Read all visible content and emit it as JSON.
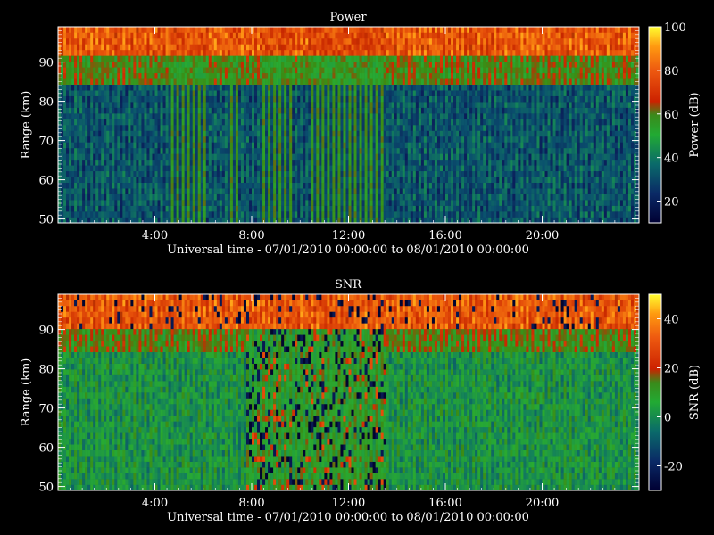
{
  "chart_data": [
    {
      "type": "heatmap",
      "title": "Power",
      "xlabel": "Universal time - 07/01/2010 00:00:00 to 08/01/2010 00:00:00",
      "ylabel": "Range (km)",
      "x_ticks": [
        "4:00",
        "8:00",
        "12:00",
        "16:00",
        "20:00"
      ],
      "x_tick_hours": [
        4,
        8,
        12,
        16,
        20
      ],
      "xlim_hours": [
        0,
        24
      ],
      "y_ticks": [
        50,
        60,
        70,
        80,
        90
      ],
      "ylim": [
        49,
        99
      ],
      "colorbar": {
        "label": "Power (dB)",
        "ticks": [
          20,
          40,
          60,
          80,
          100
        ],
        "range": [
          10,
          100
        ]
      },
      "features": {
        "echo_top_range_km": 84,
        "strong_top_range_km": 92,
        "bright_columns_hours": [
          [
            4.6,
            6.1
          ],
          [
            7.0,
            7.4
          ],
          [
            8.3,
            9.7
          ],
          [
            10.4,
            13.6
          ]
        ]
      }
    },
    {
      "type": "heatmap",
      "title": "SNR",
      "xlabel": "Universal time - 07/01/2010 00:00:00 to 08/01/2010 00:00:00",
      "ylabel": "Range (km)",
      "x_ticks": [
        "4:00",
        "8:00",
        "12:00",
        "16:00",
        "20:00"
      ],
      "x_tick_hours": [
        4,
        8,
        12,
        16,
        20
      ],
      "xlim_hours": [
        0,
        24
      ],
      "y_ticks": [
        50,
        60,
        70,
        80,
        90
      ],
      "ylim": [
        49,
        99
      ],
      "colorbar": {
        "label": "SNR (dB)",
        "ticks": [
          -20,
          0,
          20,
          40
        ],
        "range": [
          -30,
          50
        ]
      },
      "features": {
        "echo_top_range_km": 84,
        "strong_top_range_km": 90,
        "noisy_interval_hours": [
          7.8,
          13.6
        ]
      }
    }
  ]
}
